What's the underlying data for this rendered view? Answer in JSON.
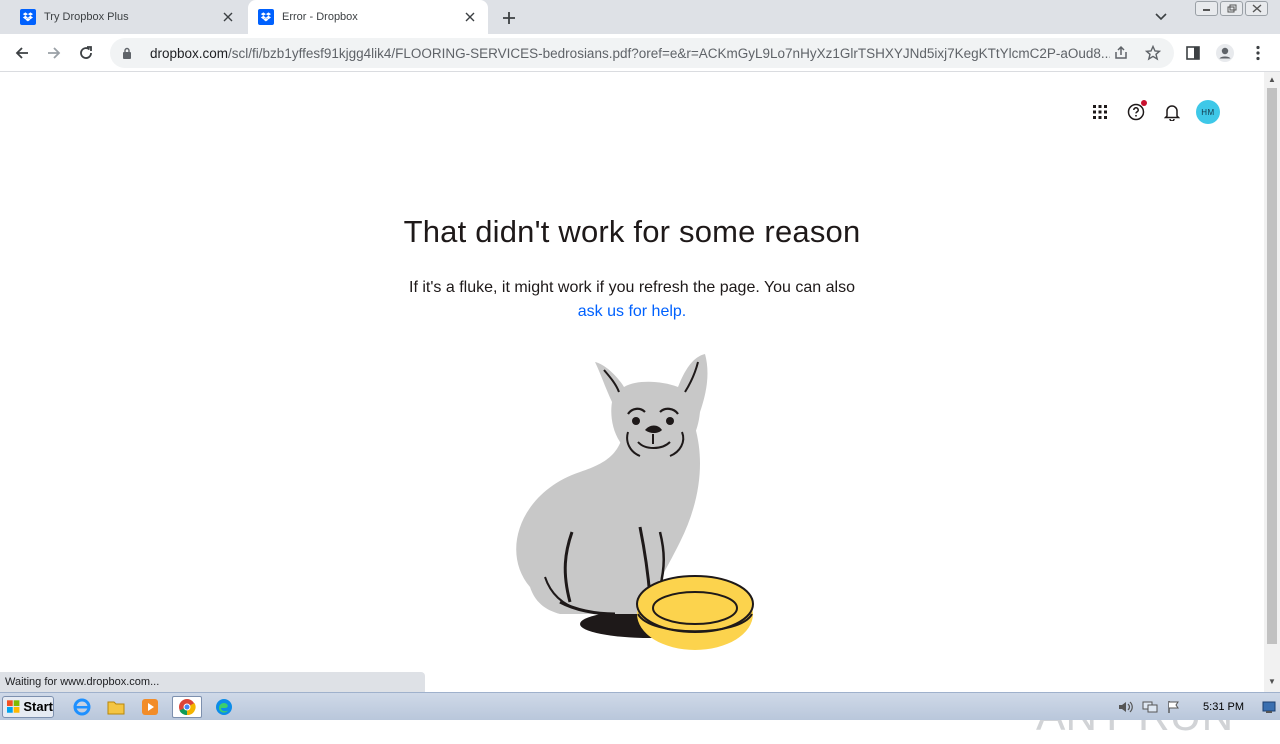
{
  "browser": {
    "tabs": [
      {
        "title": "Try Dropbox Plus",
        "favicon": "dropbox-icon",
        "active": false
      },
      {
        "title": "Error - Dropbox",
        "favicon": "dropbox-icon",
        "active": true
      }
    ],
    "url_host": "dropbox.com",
    "url_path": "/scl/fi/bzb1yffesf91kjgg4lik4/FLOORING-SERVICES-bedrosians.pdf?oref=e&r=ACKmGyL9Lo7nHyXz1GlrTSHXYJNd5ixj7KegKTtYlcmC2P-aOud8...",
    "status_text": "Waiting for www.dropbox.com..."
  },
  "page": {
    "avatar_initials": "HM",
    "error_title": "That didn't work for some reason",
    "error_text": "If it's a fluke, it might work if you refresh the page. You can also",
    "help_link": "ask us for help.",
    "watermark": "ANY RUN"
  },
  "taskbar": {
    "start_label": "Start",
    "clock": "5:31 PM"
  },
  "colors": {
    "link": "#0061fe",
    "avatar": "#3ec8e8",
    "bowl": "#fcd34d",
    "dog": "#c8c8c8"
  }
}
